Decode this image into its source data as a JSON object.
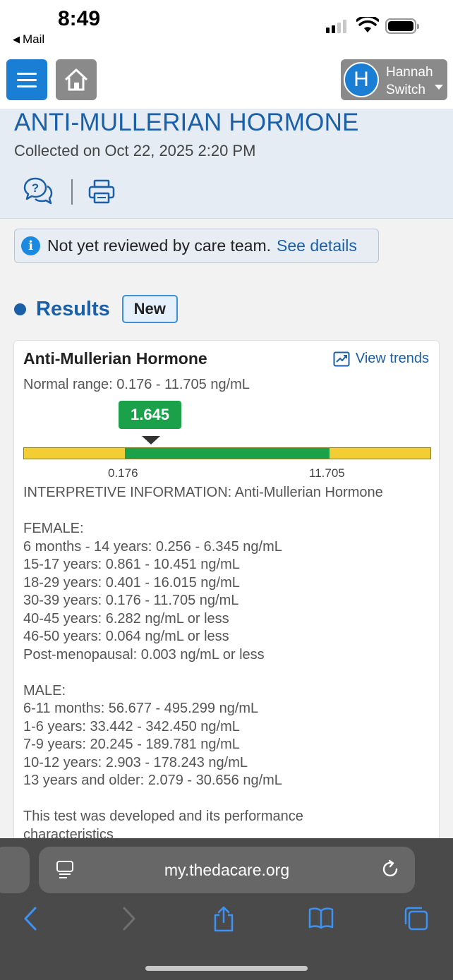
{
  "status": {
    "time": "8:49",
    "back_app": "Mail"
  },
  "header": {
    "user_initial": "H",
    "user_name_line1": "Hannah",
    "user_name_line2": "Switch"
  },
  "test": {
    "title": "ANTI-MULLERIAN HORMONE",
    "collected": "Collected on Oct 22, 2025 2:20 PM"
  },
  "review": {
    "text": "Not yet reviewed by care team.",
    "link": "See details"
  },
  "results": {
    "heading": "Results",
    "badge": "New",
    "card_title": "Anti-Mullerian Hormone",
    "view_trends": "View trends",
    "normal_range": "Normal range: 0.176 - 11.705 ng/mL",
    "value": "1.645",
    "range_low": "0.176",
    "range_high": "11.705",
    "interpretive_lines": [
      "INTERPRETIVE INFORMATION: Anti-Mullerian Hormone",
      "",
      "FEMALE:",
      "6 months - 14 years: 0.256 - 6.345 ng/mL",
      "15-17 years: 0.861 - 10.451 ng/mL",
      "18-29 years: 0.401 - 16.015 ng/mL",
      "30-39 years: 0.176 - 11.705 ng/mL",
      "40-45 years: 6.282 ng/mL or less",
      "46-50 years: 0.064 ng/mL or less",
      "Post-menopausal: 0.003 ng/mL or less",
      "",
      "MALE:",
      "6-11 months: 56.677 - 495.299 ng/mL",
      "1-6 years: 33.442 - 342.450 ng/mL",
      "7-9 years: 20.245 - 189.781 ng/mL",
      "10-12 years: 2.903 - 178.243 ng/mL",
      "13 years and older: 2.079 - 30.656 ng/mL",
      "",
      "This test was developed and its performance",
      "characteristics"
    ]
  },
  "browser": {
    "url": "my.thedacare.org"
  },
  "colors": {
    "brand_blue": "#1a5fa8",
    "normal_green": "#1aa14a",
    "out_of_range_yellow": "#f2cd33"
  }
}
